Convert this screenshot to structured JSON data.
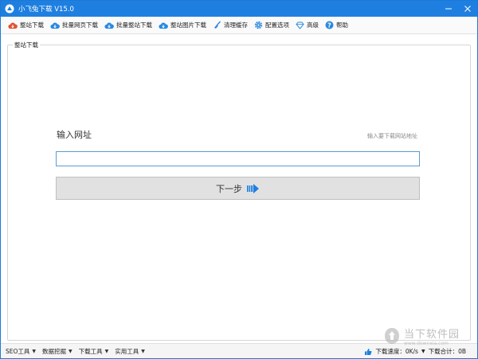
{
  "window": {
    "title": "小飞兔下载 V15.0",
    "accent": "#1e7fe0"
  },
  "toolbar": {
    "items": [
      {
        "label": "整站下载",
        "icon": "cloud-download-red-icon"
      },
      {
        "label": "批量网页下载",
        "icon": "cloud-download-icon"
      },
      {
        "label": "批量整站下载",
        "icon": "cloud-download-icon"
      },
      {
        "label": "整站图片下载",
        "icon": "cloud-download-icon"
      },
      {
        "label": "清理缓存",
        "icon": "broom-icon"
      },
      {
        "label": "配置选项",
        "icon": "gear-icon"
      },
      {
        "label": "高级",
        "icon": "gem-icon"
      },
      {
        "label": "帮助",
        "icon": "help-icon"
      }
    ]
  },
  "panel": {
    "legend": "整站下载",
    "url_label": "输入网址",
    "url_hint": "输入要下载网站地址",
    "url_value": "",
    "next_label": "下一步"
  },
  "statusbar": {
    "menus": [
      "SEO工具",
      "数据挖掘",
      "下载工具",
      "实用工具"
    ],
    "speed": "下载速度：0K/s",
    "total": "下载合计：0B"
  },
  "watermark": {
    "name": "当下软件园",
    "url": "www.downxia.com"
  }
}
